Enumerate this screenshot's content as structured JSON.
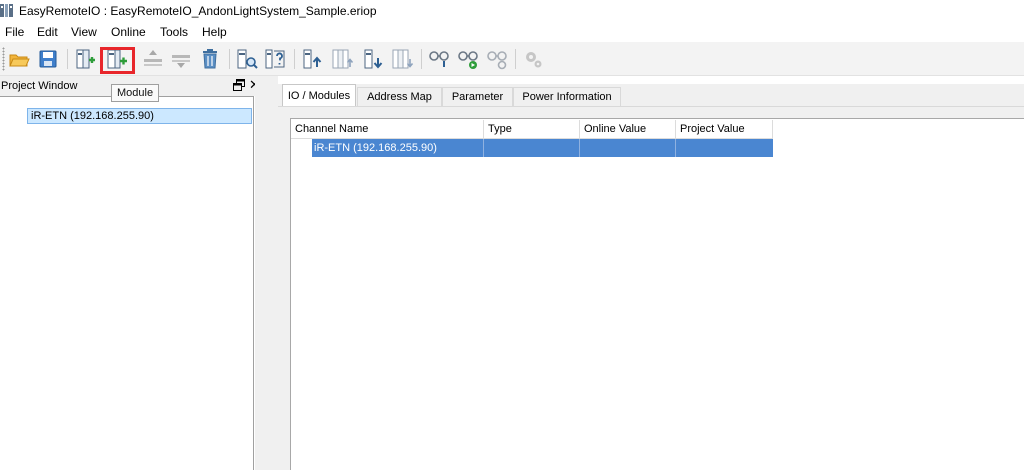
{
  "window": {
    "title": "EasyRemoteIO : EasyRemoteIO_AndonLightSystem_Sample.eriop",
    "app_icon": "app-logo-icon"
  },
  "menu": {
    "items": [
      "File",
      "Edit",
      "View",
      "Online",
      "Tools",
      "Help"
    ]
  },
  "toolbar": {
    "buttons": [
      {
        "name": "open-folder-icon"
      },
      {
        "name": "save-icon"
      },
      {
        "name": "add-station-icon"
      },
      {
        "name": "add-module-icon"
      },
      {
        "name": "move-up-icon"
      },
      {
        "name": "move-down-icon"
      },
      {
        "name": "delete-icon"
      },
      {
        "name": "search-device-icon"
      },
      {
        "name": "io-check-icon"
      },
      {
        "name": "upload-icon"
      },
      {
        "name": "upload-all-icon"
      },
      {
        "name": "download-icon"
      },
      {
        "name": "download-all-icon"
      },
      {
        "name": "connect-icon"
      },
      {
        "name": "run-icon"
      },
      {
        "name": "disconnect-icon"
      },
      {
        "name": "settings-icon"
      }
    ],
    "tooltip": "Module",
    "highlight_color": "#e8262b"
  },
  "project_window": {
    "title": "Project Window",
    "tree": [
      "iR-ETN (192.168.255.90)"
    ]
  },
  "tabs": [
    {
      "label": "IO / Modules",
      "active": true
    },
    {
      "label": "Address Map",
      "active": false
    },
    {
      "label": "Parameter",
      "active": false
    },
    {
      "label": "Power Information",
      "active": false
    }
  ],
  "grid": {
    "columns": [
      "Channel Name",
      "Type",
      "Online Value",
      "Project Value"
    ],
    "rows": [
      {
        "channel_name": "iR-ETN (192.168.255.90)",
        "type": "",
        "online_value": "",
        "project_value": ""
      }
    ],
    "selection_color": "#4a86d1"
  }
}
